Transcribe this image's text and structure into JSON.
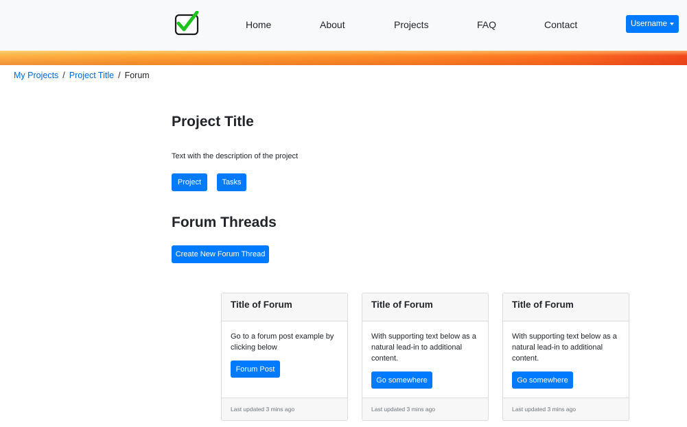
{
  "nav": {
    "items": [
      "Home",
      "About",
      "Projects",
      "FAQ",
      "Contact"
    ],
    "user_label": "Username"
  },
  "breadcrumb": {
    "items": [
      "My Projects",
      "Project Title"
    ],
    "current": "Forum"
  },
  "project": {
    "title": "Project Title",
    "description": "Text with the description of the project",
    "buttons": [
      "Project",
      "Tasks"
    ]
  },
  "forum": {
    "heading": "Forum Threads",
    "create_button": "Create New Forum Thread",
    "cards": [
      {
        "title": "Title of Forum",
        "text": "Go to a forum post example by clicking below",
        "button": "Forum Post",
        "footer": "Last updated 3 mins ago"
      },
      {
        "title": "Title of Forum",
        "text": "With supporting text below as a natural lead-in to additional content.",
        "button": "Go somewhere",
        "footer": "Last updated 3 mins ago"
      },
      {
        "title": "Title of Forum",
        "text": "With supporting text below as a natural lead-in to additional content.",
        "button": "Go somewhere",
        "footer": "Last updated 3 mins ago"
      }
    ]
  },
  "colors": {
    "primary": "#007bff",
    "link": "#0069d9",
    "navbar_bg": "#f8f9fa",
    "check_green": "#1ec41e"
  },
  "icons": {
    "logo": "checkbox-check-icon",
    "user_caret": "caret-down-icon"
  }
}
